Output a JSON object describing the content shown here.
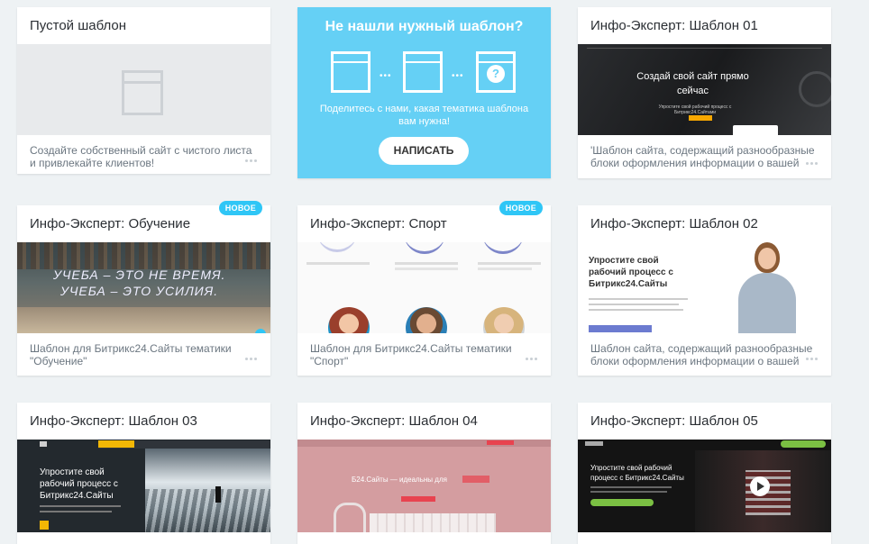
{
  "cards": [
    {
      "title": "Пустой шаблон",
      "desc": "Создайте собственный сайт с чистого листа и привлекайте клиентов!"
    },
    {
      "title": "Не нашли нужный шаблон?",
      "desc": "Поделитесь с нами, какая тематика шаблона вам нужна!",
      "button": "НАПИСАТЬ"
    },
    {
      "title": "Инфо-Эксперт: Шаблон 01",
      "desc": "'Шаблон сайта, содержащий разнообразные блоки оформления информации о вашей",
      "preview_heading": "Создай свой сайт прямо сейчас",
      "preview_sub": "Упростите свой рабочий процесс с Битрикс24.Сайтами"
    },
    {
      "title": "Инфо-Эксперт: Обучение",
      "desc": "Шаблон для Битрикс24.Сайты тематики \"Обучение\"",
      "badge": "НОВОЕ",
      "preview_line1": "УЧЕБА – ЭТО НЕ ВРЕМЯ.",
      "preview_line2": "УЧЕБА – ЭТО УСИЛИЯ."
    },
    {
      "title": "Инфо-Эксперт: Спорт",
      "desc": "Шаблон для Битрикс24.Сайты тематики \"Спорт\"",
      "badge": "НОВОЕ"
    },
    {
      "title": "Инфо-Эксперт: Шаблон 02",
      "desc": "Шаблон сайта, содержащий разнообразные блоки оформления информации о вашей",
      "preview_heading": "Упростите свой рабочий процесс с Битрикс24.Сайты"
    },
    {
      "title": "Инфо-Эксперт: Шаблон 03",
      "preview_heading": "Упростите свой рабочий процесс с Битрикс24.Сайты"
    },
    {
      "title": "Инфо-Эксперт: Шаблон 04",
      "preview_heading": "Б24.Сайты — идеальны для"
    },
    {
      "title": "Инфо-Эксперт: Шаблон 05",
      "preview_heading": "Упростите свой рабочий процесс с Битрикс24.Сайты"
    }
  ]
}
